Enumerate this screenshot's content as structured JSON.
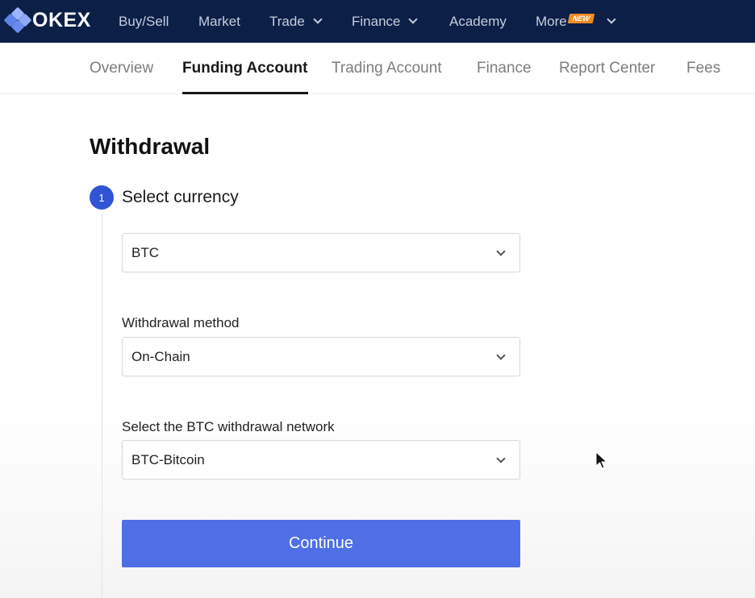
{
  "brand": {
    "name": "OKEX"
  },
  "topnav": {
    "items": [
      {
        "label": "Buy/Sell",
        "dropdown": false
      },
      {
        "label": "Market",
        "dropdown": false
      },
      {
        "label": "Trade",
        "dropdown": true
      },
      {
        "label": "Finance",
        "dropdown": true
      },
      {
        "label": "Academy",
        "dropdown": false
      },
      {
        "label": "More",
        "dropdown": true,
        "badge": "NEW"
      }
    ]
  },
  "subtabs": [
    {
      "label": "Overview",
      "active": false
    },
    {
      "label": "Funding Account",
      "active": true
    },
    {
      "label": "Trading Account",
      "active": false
    },
    {
      "label": "Finance",
      "active": false
    },
    {
      "label": "Report Center",
      "active": false
    },
    {
      "label": "Fees",
      "active": false
    }
  ],
  "page": {
    "title": "Withdrawal",
    "step": {
      "number": "1",
      "label": "Select currency"
    },
    "currency": {
      "value": "BTC"
    },
    "method": {
      "label": "Withdrawal method",
      "value": "On-Chain"
    },
    "network": {
      "label": "Select the BTC withdrawal network",
      "value": "BTC-Bitcoin"
    },
    "continue_label": "Continue"
  },
  "colors": {
    "nav_bg": "#0b1f47",
    "accent": "#4f6fe6",
    "step_circle": "#2f55d4",
    "badge": "#f08a24"
  }
}
